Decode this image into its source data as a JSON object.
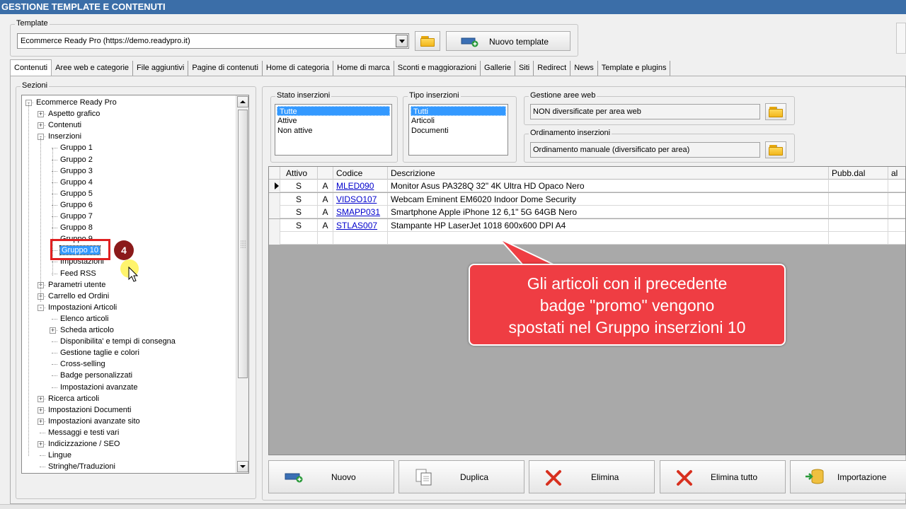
{
  "window": {
    "title": "GESTIONE TEMPLATE E CONTENUTI"
  },
  "template_group": {
    "label": "Template",
    "selected": "Ecommerce Ready Pro (https://demo.readypro.it)",
    "new_button": "Nuovo template"
  },
  "tabs": [
    {
      "label": "Contenuti",
      "active": true
    },
    {
      "label": "Aree web e categorie"
    },
    {
      "label": "File aggiuntivi"
    },
    {
      "label": "Pagine di contenuti"
    },
    {
      "label": "Home di categoria"
    },
    {
      "label": "Home di marca"
    },
    {
      "label": "Sconti e maggiorazioni"
    },
    {
      "label": "Gallerie"
    },
    {
      "label": "Siti"
    },
    {
      "label": "Redirect"
    },
    {
      "label": "News"
    },
    {
      "label": "Template e plugins"
    }
  ],
  "sections": {
    "label": "Sezioni",
    "tree": [
      {
        "label": "Ecommerce Ready Pro",
        "level": 0,
        "expander": "-"
      },
      {
        "label": "Aspetto grafico",
        "level": 1,
        "expander": "+"
      },
      {
        "label": "Contenuti",
        "level": 1,
        "expander": "+"
      },
      {
        "label": "Inserzioni",
        "level": 1,
        "expander": "-"
      },
      {
        "label": "Gruppo 1",
        "level": 2
      },
      {
        "label": "Gruppo 2",
        "level": 2
      },
      {
        "label": "Gruppo 3",
        "level": 2
      },
      {
        "label": "Gruppo 4",
        "level": 2
      },
      {
        "label": "Gruppo 5",
        "level": 2
      },
      {
        "label": "Gruppo 6",
        "level": 2
      },
      {
        "label": "Gruppo 7",
        "level": 2
      },
      {
        "label": "Gruppo 8",
        "level": 2
      },
      {
        "label": "Gruppo 9",
        "level": 2
      },
      {
        "label": "Gruppo 10",
        "level": 2,
        "selected": true
      },
      {
        "label": "Impostazioni",
        "level": 2
      },
      {
        "label": "Feed RSS",
        "level": 2
      },
      {
        "label": "Parametri utente",
        "level": 1,
        "expander": "+"
      },
      {
        "label": "Carrello ed Ordini",
        "level": 1,
        "expander": "+"
      },
      {
        "label": "Impostazioni Articoli",
        "level": 1,
        "expander": "-"
      },
      {
        "label": "Elenco articoli",
        "level": 2
      },
      {
        "label": "Scheda articolo",
        "level": 2,
        "expander": "+"
      },
      {
        "label": "Disponibilita' e tempi di consegna",
        "level": 2
      },
      {
        "label": "Gestione taglie e colori",
        "level": 2
      },
      {
        "label": "Cross-selling",
        "level": 2
      },
      {
        "label": "Badge personalizzati",
        "level": 2
      },
      {
        "label": "Impostazioni avanzate",
        "level": 2
      },
      {
        "label": "Ricerca articoli",
        "level": 1,
        "expander": "+"
      },
      {
        "label": "Impostazioni Documenti",
        "level": 1,
        "expander": "+"
      },
      {
        "label": "Impostazioni avanzate sito",
        "level": 1,
        "expander": "+"
      },
      {
        "label": "Messaggi e testi vari",
        "level": 1
      },
      {
        "label": "Indicizzazione / SEO",
        "level": 1,
        "expander": "+"
      },
      {
        "label": "Lingue",
        "level": 1
      },
      {
        "label": "Stringhe/Traduzioni",
        "level": 1
      }
    ]
  },
  "stato_inserzioni": {
    "label": "Stato inserzioni",
    "items": [
      "Tutte",
      "Attive",
      "Non attive"
    ],
    "selected": 0
  },
  "tipo_inserzioni": {
    "label": "Tipo inserzioni",
    "items": [
      "Tutti",
      "Articoli",
      "Documenti"
    ],
    "selected": 0
  },
  "gestione_aree_web": {
    "label": "Gestione aree web",
    "value": "NON diversificate per area web"
  },
  "ordinamento_inserzioni": {
    "label": "Ordinamento inserzioni",
    "value": "Ordinamento manuale (diversificato per area)"
  },
  "grid": {
    "columns": [
      "Attivo",
      "",
      "Codice",
      "Descrizione",
      "Pubb.dal",
      "al"
    ],
    "rows": [
      {
        "attivo": "S",
        "tipo": "A",
        "codice": "MLED090",
        "descrizione": "Monitor Asus PA328Q 32\" 4K Ultra HD Opaco Nero",
        "current": true
      },
      {
        "attivo": "S",
        "tipo": "A",
        "codice": "VIDSO107",
        "descrizione": "Webcam Eminent EM6020 Indoor Dome Security"
      },
      {
        "attivo": "S",
        "tipo": "A",
        "codice": "SMAPP031",
        "descrizione": "Smartphone Apple iPhone 12 6,1\" 5G 64GB Nero"
      },
      {
        "attivo": "S",
        "tipo": "A",
        "codice": "STLAS007",
        "descrizione": "Stampante HP LaserJet 1018 600x600 DPI A4"
      }
    ]
  },
  "actions": {
    "nuovo": "Nuovo",
    "duplica": "Duplica",
    "elimina": "Elimina",
    "elimina_tutto": "Elimina tutto",
    "importazione": "Importazione"
  },
  "annotation": {
    "step": "4",
    "callout_lines": [
      "Gli articoli con il precedente",
      "badge \"promo\" vengono",
      "spostati nel Gruppo inserzioni 10"
    ],
    "callout_color": "#ef3d43"
  }
}
